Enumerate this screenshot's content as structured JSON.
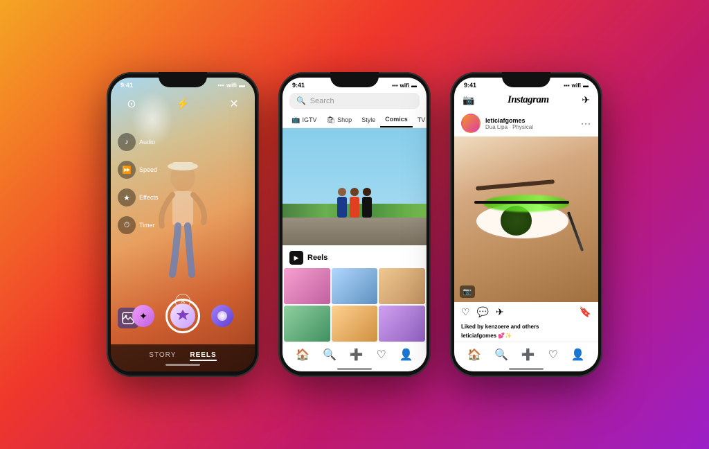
{
  "background": {
    "gradient": "linear-gradient(135deg, #f5a623 0%, #f0372b 35%, #c0196b 65%, #9b1fc8 100%)"
  },
  "phone1": {
    "status_time": "9:41",
    "top_icon_left": "⊙",
    "top_icon_right": "✕",
    "flash_icon": "⚡",
    "side_controls": [
      {
        "icon": "♪",
        "label": "Audio"
      },
      {
        "icon": "⏩",
        "label": "Speed"
      },
      {
        "icon": "★",
        "label": "Effects"
      },
      {
        "icon": "⏱",
        "label": "Timer"
      }
    ],
    "close_label": "✕",
    "tabs": [
      {
        "label": "STORY",
        "active": false
      },
      {
        "label": "REELS",
        "active": true
      }
    ],
    "camera_icon": "📷"
  },
  "phone2": {
    "status_time": "9:41",
    "search_placeholder": "Search",
    "categories": [
      {
        "label": "IGTV",
        "icon": "📺",
        "active": false
      },
      {
        "label": "Shop",
        "icon": "🛍",
        "active": false
      },
      {
        "label": "Style",
        "icon": "",
        "active": false
      },
      {
        "label": "Comics",
        "icon": "",
        "active": false
      },
      {
        "label": "TV & Mo...",
        "icon": "",
        "active": false
      }
    ],
    "reels_label": "Reels",
    "nav_icons": [
      "🏠",
      "🔍",
      "➕",
      "♡",
      "👤"
    ]
  },
  "phone3": {
    "status_time": "9:41",
    "app_logo": "Instagram",
    "camera_icon": "📷",
    "send_icon": "✈",
    "user": {
      "name": "leticiafgomes",
      "subtitle": "Dua Lipa · Physical"
    },
    "more_icon": "···",
    "liked_by": "Liked by kenzoere and others",
    "caption": "leticiafgomes",
    "caption_emojis": "💕✨",
    "nav_icons": [
      "🏠",
      "🔍",
      "➕",
      "♡",
      "👤"
    ]
  }
}
